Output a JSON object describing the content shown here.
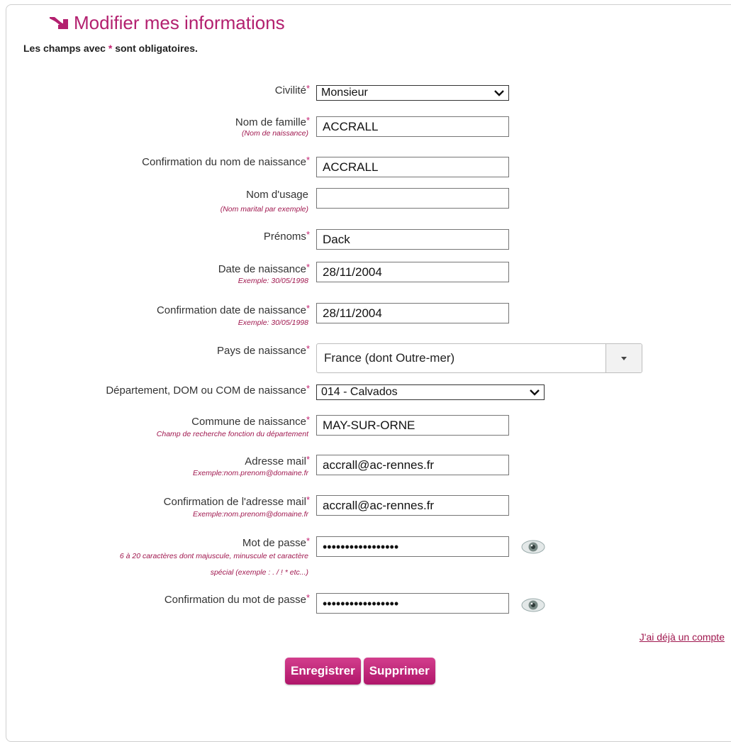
{
  "title": "Modifier mes informations",
  "subtitle": {
    "before": "Les champs avec ",
    "star": "*",
    "after": " sont obligatoires."
  },
  "required_mark": "*",
  "colors": {
    "accent": "#b3206f",
    "hint": "#a0184f"
  },
  "fields": {
    "civilite": {
      "label": "Civilité",
      "value": "Monsieur"
    },
    "nom_famille": {
      "label": "Nom de famille",
      "hint": "(Nom de naissance)",
      "value": "ACCRALL"
    },
    "conf_nom": {
      "label": "Confirmation du nom de naissance",
      "value": "ACCRALL"
    },
    "nom_usage": {
      "label": "Nom d'usage",
      "hint": "(Nom marital par exemple)",
      "value": ""
    },
    "prenoms": {
      "label": "Prénoms",
      "value": "Dack"
    },
    "date_naissance": {
      "label": "Date de naissance",
      "hint": "Exemple: 30/05/1998",
      "value": "28/11/2004"
    },
    "conf_date": {
      "label": "Confirmation date de naissance",
      "hint": "Exemple: 30/05/1998",
      "value": "28/11/2004"
    },
    "pays": {
      "label": "Pays de naissance",
      "value": "France (dont Outre-mer)"
    },
    "departement": {
      "label": "Département, DOM ou COM de naissance",
      "value": "014 - Calvados"
    },
    "commune": {
      "label": "Commune de naissance",
      "hint": "Champ de recherche fonction du département",
      "value": "MAY-SUR-ORNE"
    },
    "email": {
      "label": "Adresse mail",
      "hint": "Exemple:nom.prenom@domaine.fr",
      "value": "accrall@ac-rennes.fr"
    },
    "conf_email": {
      "label": "Confirmation de l'adresse mail",
      "hint": "Exemple:nom.prenom@domaine.fr",
      "value": "accrall@ac-rennes.fr"
    },
    "mdp": {
      "label": "Mot de passe",
      "hint1": "6 à 20 caractères dont majuscule, minuscule et caractère",
      "hint2": "spécial (exemple : . / ! * etc...)",
      "value": "•••••••••••••••••"
    },
    "conf_mdp": {
      "label": "Confirmation du mot de passe",
      "value": "•••••••••••••••••"
    }
  },
  "link_account": "J'ai déjà un compte",
  "buttons": {
    "save": "Enregistrer",
    "delete": "Supprimer"
  }
}
